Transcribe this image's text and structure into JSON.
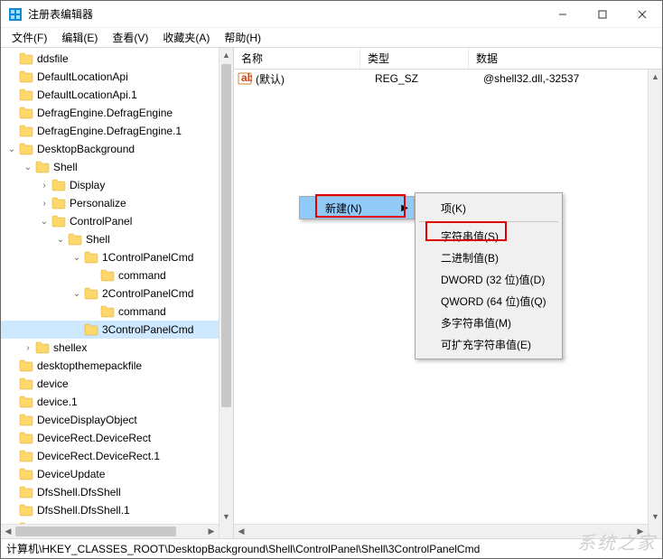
{
  "window": {
    "title": "注册表编辑器"
  },
  "menu": {
    "file": "文件(F)",
    "edit": "编辑(E)",
    "view": "查看(V)",
    "fav": "收藏夹(A)",
    "help": "帮助(H)"
  },
  "tree": [
    {
      "indent": 0,
      "twisty": "",
      "label": "ddsfile"
    },
    {
      "indent": 0,
      "twisty": "",
      "label": "DefaultLocationApi"
    },
    {
      "indent": 0,
      "twisty": "",
      "label": "DefaultLocationApi.1"
    },
    {
      "indent": 0,
      "twisty": "",
      "label": "DefragEngine.DefragEngine"
    },
    {
      "indent": 0,
      "twisty": "",
      "label": "DefragEngine.DefragEngine.1"
    },
    {
      "indent": 0,
      "twisty": "open",
      "label": "DesktopBackground"
    },
    {
      "indent": 1,
      "twisty": "open",
      "label": "Shell"
    },
    {
      "indent": 2,
      "twisty": "closed",
      "label": "Display"
    },
    {
      "indent": 2,
      "twisty": "closed",
      "label": "Personalize"
    },
    {
      "indent": 2,
      "twisty": "open",
      "label": "ControlPanel"
    },
    {
      "indent": 3,
      "twisty": "open",
      "label": "Shell"
    },
    {
      "indent": 4,
      "twisty": "open",
      "label": "1ControlPanelCmd"
    },
    {
      "indent": 5,
      "twisty": "",
      "label": "command"
    },
    {
      "indent": 4,
      "twisty": "open",
      "label": "2ControlPanelCmd"
    },
    {
      "indent": 5,
      "twisty": "",
      "label": "command"
    },
    {
      "indent": 4,
      "twisty": "",
      "label": "3ControlPanelCmd",
      "selected": true
    },
    {
      "indent": 1,
      "twisty": "closed",
      "label": "shellex"
    },
    {
      "indent": 0,
      "twisty": "",
      "label": "desktopthemepackfile"
    },
    {
      "indent": 0,
      "twisty": "",
      "label": "device"
    },
    {
      "indent": 0,
      "twisty": "",
      "label": "device.1"
    },
    {
      "indent": 0,
      "twisty": "",
      "label": "DeviceDisplayObject"
    },
    {
      "indent": 0,
      "twisty": "",
      "label": "DeviceRect.DeviceRect"
    },
    {
      "indent": 0,
      "twisty": "",
      "label": "DeviceRect.DeviceRect.1"
    },
    {
      "indent": 0,
      "twisty": "",
      "label": "DeviceUpdate"
    },
    {
      "indent": 0,
      "twisty": "",
      "label": "DfsShell.DfsShell"
    },
    {
      "indent": 0,
      "twisty": "",
      "label": "DfsShell.DfsShell.1"
    },
    {
      "indent": 0,
      "twisty": "",
      "label": "DfsShell.DfsShellAdmin"
    }
  ],
  "list": {
    "head": {
      "name": "名称",
      "type": "类型",
      "data": "数据"
    },
    "rows": [
      {
        "name": "(默认)",
        "type": "REG_SZ",
        "data": "@shell32.dll,-32537"
      }
    ]
  },
  "context": {
    "new": "新建(N)",
    "sub": {
      "key": "项(K)",
      "string": "字符串值(S)",
      "binary": "二进制值(B)",
      "dword": "DWORD (32 位)值(D)",
      "qword": "QWORD (64 位)值(Q)",
      "multi": "多字符串值(M)",
      "expand": "可扩充字符串值(E)"
    }
  },
  "status": "计算机\\HKEY_CLASSES_ROOT\\DesktopBackground\\Shell\\ControlPanel\\Shell\\3ControlPanelCmd",
  "watermark": "系统之家",
  "icons": {
    "app": "regedit-icon",
    "folder": "folder-icon",
    "string": "reg-string-icon"
  }
}
